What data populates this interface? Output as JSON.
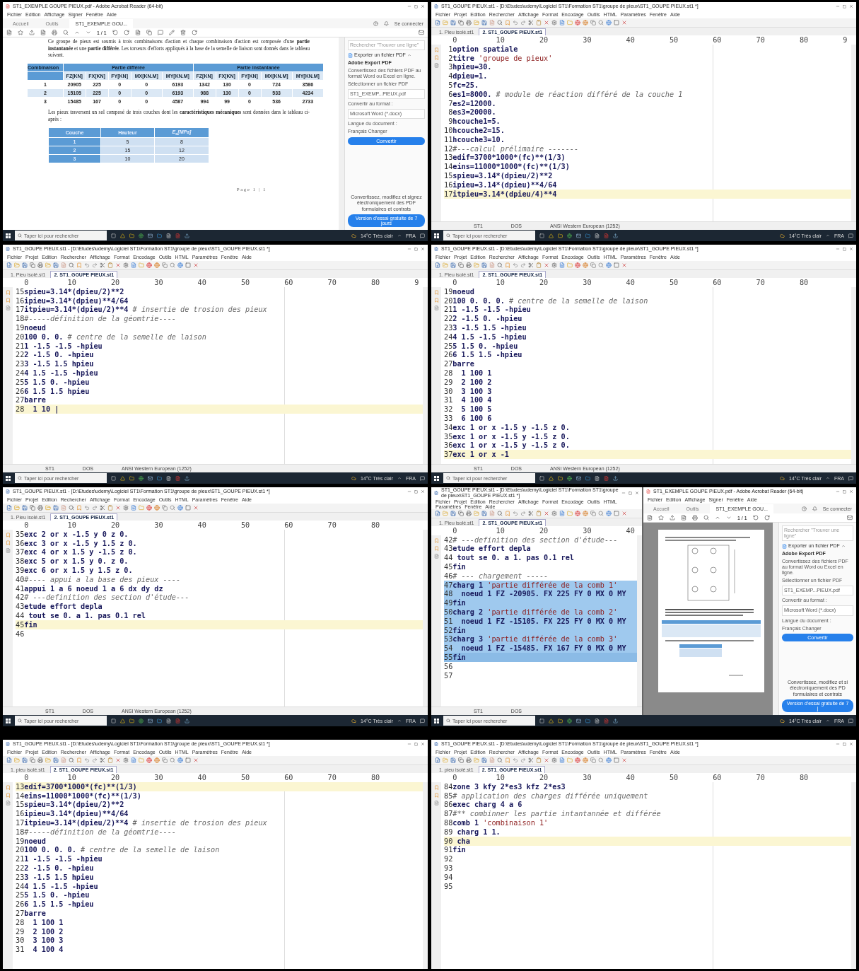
{
  "panels": [
    {
      "kind": "pdf",
      "pdf": {
        "title": "ST1_EXEMPLE GOUPE PIEUX.pdf - Adobe Acrobat Reader (64-bit)",
        "menu": [
          "Fichier",
          "Edition",
          "Affichage",
          "Signer",
          "Fenêtre",
          "Aide"
        ],
        "tabs": [
          {
            "label": "Accueil",
            "selected": false
          },
          {
            "label": "Outils",
            "selected": false
          },
          {
            "label": "ST1_EXEMPLE GOU...",
            "selected": true
          }
        ],
        "account": "Se connecter",
        "page": "1 / 1",
        "doc": {
          "para1": "Ce groupe de pieux est soumis à trois combinaisons d'action et chaque combinaison d'action est composée d'une **partie instantanée** et une **partie différée**. Les torseurs d'efforts appliqués à la base de la semelle de liaison sont donnés dans le tableau suivant.",
          "table1": {
            "groups": [
              "Combinaison",
              "Partie différée",
              "Partie instantanée"
            ],
            "columns": [
              "",
              "FZ[KN]",
              "FX[KN]",
              "FY[KN]",
              "MX[KN.M]",
              "MY[KN.M]",
              "FZ[KN]",
              "FX[KN]",
              "FY[KN]",
              "MX[KN.M]",
              "MY[KN.M]"
            ],
            "rows": [
              [
                "1",
                "20905",
                "225",
                "0",
                "0",
                "6193",
                "1342",
                "130",
                "0",
                "724",
                "3586"
              ],
              [
                "2",
                "15105",
                "225",
                "0",
                "0",
                "6193",
                "988",
                "130",
                "0",
                "533",
                "4234"
              ],
              [
                "3",
                "15485",
                "167",
                "0",
                "0",
                "4587",
                "994",
                "99",
                "0",
                "536",
                "2733"
              ]
            ]
          },
          "para2": "Les pieux traversent un sol composé de trois couches dont les **caractéristiques mécaniques** sont données dans le tableau ci-après :",
          "table2": {
            "columns": [
              "Couche",
              "Hauteur",
              "E$_{s}$[MPa]"
            ],
            "rows": [
              [
                "1",
                "5",
                "8"
              ],
              [
                "2",
                "15",
                "12"
              ],
              [
                "3",
                "10",
                "20"
              ]
            ]
          },
          "footer": "Page 1 | 1"
        },
        "sidebar": {
          "search": "Rechercher \"Trouver une ligne\"",
          "export": "Exporter un fichier PDF",
          "heading": "Adobe Export PDF",
          "desc": "Convertissez des fichiers PDF au format Word ou Excel en ligne.",
          "select_label": "Sélectionner un fichier PDF",
          "file": "ST1_EXEMP...PIEUX.pdf",
          "format_label": "Convertir au format :",
          "format": "Microsoft Word (*.docx)",
          "lang_label": "Langue du document :",
          "lang": "Français  Changer",
          "button": "Convertir",
          "promo": [
            "Convertissez, modifiez et signez",
            "électroniquement des PDF",
            "formulaires et contrats"
          ],
          "promo_button": "Version d'essai gratuite de 7 jours"
        }
      },
      "taskbar": {
        "search": "Taper ici pour rechercher",
        "weather": "14°C  Très clair",
        "lang": "FRA"
      }
    },
    {
      "kind": "editor",
      "editor": {
        "title": "ST1_GOUPE PIEUX.st1 - [D:\\Etudes\\udemy\\Logiciel ST1\\Formation ST1\\groupe de pieux\\ST1_GOUPE PIEUX.st1 *]",
        "menu": [
          "Fichier",
          "Projet",
          "Edition",
          "Rechercher",
          "Affichage",
          "Format",
          "Encodage",
          "Outils",
          "HTML",
          "Paramètres",
          "Fenêtre",
          "Aide"
        ],
        "tabs": [
          {
            "label": "1. Pieu isolé.st1",
            "selected": false
          },
          {
            "label": "2. ST1_GOUPE PIEUX.st1",
            "selected": true
          }
        ],
        "ruler": [
          "0",
          "10",
          "20",
          "30",
          "40",
          "50",
          "60",
          "70",
          "80",
          "9"
        ],
        "lines": [
          {
            "n": "1",
            "parts": [
              {
                "kind": "code",
                "text": "option spatiale"
              }
            ]
          },
          {
            "n": "2",
            "parts": [
              {
                "kind": "code",
                "text": "titre "
              },
              {
                "kind": "string",
                "text": "'groupe de pieux'"
              }
            ]
          },
          {
            "n": "3",
            "parts": [
              {
                "kind": "code",
                "text": "hpieu=30."
              }
            ]
          },
          {
            "n": "4",
            "parts": [
              {
                "kind": "code",
                "text": "dpieu=1."
              }
            ]
          },
          {
            "n": "5",
            "parts": [
              {
                "kind": "code",
                "text": "fc=25."
              }
            ]
          },
          {
            "n": "6",
            "parts": [
              {
                "kind": "code",
                "text": "es1=8000. "
              },
              {
                "kind": "comment",
                "text": "# module de réaction différé de la couche 1"
              }
            ]
          },
          {
            "n": "7",
            "parts": [
              {
                "kind": "code",
                "text": "es2=12000."
              }
            ]
          },
          {
            "n": "8",
            "parts": [
              {
                "kind": "code",
                "text": "es3=20000."
              }
            ]
          },
          {
            "n": "9",
            "parts": [
              {
                "kind": "code",
                "text": "hcouche1=5."
              }
            ]
          },
          {
            "n": "10",
            "parts": [
              {
                "kind": "code",
                "text": "hcouche2=15."
              }
            ]
          },
          {
            "n": "11",
            "parts": [
              {
                "kind": "code",
                "text": "hcouche3=10."
              }
            ]
          },
          {
            "n": "12",
            "parts": [
              {
                "kind": "comment",
                "text": "#---calcul prélimaire -------"
              }
            ]
          },
          {
            "n": "13",
            "parts": [
              {
                "kind": "code",
                "text": "edif=3700*1000*(fc)**(1/3)"
              }
            ]
          },
          {
            "n": "14",
            "parts": [
              {
                "kind": "code",
                "text": "eins=11000*1000*(fc)**(1/3)"
              }
            ]
          },
          {
            "n": "15",
            "parts": [
              {
                "kind": "code",
                "text": "spieu=3.14*(dpieu/2)**2"
              }
            ]
          },
          {
            "n": "16",
            "parts": [
              {
                "kind": "code",
                "text": "ipieu=3.14*(dpieu)**4/64"
              }
            ]
          },
          {
            "n": "17",
            "current": true,
            "parts": [
              {
                "kind": "code",
                "text": "itpieu=3.14*(dpieu/4)**4"
              }
            ]
          }
        ],
        "status": [
          "ST1",
          "DOS",
          "ANSI Western European (1252)"
        ]
      },
      "taskbar": {
        "search": "Taper ici pour rechercher",
        "weather": "14°C  Très clair",
        "lang": "FRA"
      }
    },
    {
      "kind": "editor",
      "editor": {
        "title": "ST1_GOUPE PIEUX.st1 - [D:\\Etudes\\udemy\\Logiciel ST1\\Formation ST1\\groupe de pieux\\ST1_GOUPE PIEUX.st1 *]",
        "menu": [
          "Fichier",
          "Projet",
          "Edition",
          "Rechercher",
          "Affichage",
          "Format",
          "Encodage",
          "Outils",
          "HTML",
          "Paramètres",
          "Fenêtre",
          "Aide"
        ],
        "tabs": [
          {
            "label": "1. Pieu isolé.st1",
            "selected": false
          },
          {
            "label": "2. ST1_GOUPE PIEUX.st1",
            "selected": true
          }
        ],
        "ruler": [
          "0",
          "10",
          "20",
          "30",
          "40",
          "50",
          "60",
          "70",
          "80",
          "9"
        ],
        "lines": [
          {
            "n": "15",
            "parts": [
              {
                "kind": "code",
                "text": "spieu=3.14*(dpieu/2)**2"
              }
            ]
          },
          {
            "n": "16",
            "parts": [
              {
                "kind": "code",
                "text": "ipieu=3.14*(dpieu)**4/64"
              }
            ]
          },
          {
            "n": "17",
            "parts": [
              {
                "kind": "code",
                "text": "itpieu=3.14*(dpieu/2)**4 "
              },
              {
                "kind": "comment",
                "text": "# insertie de trosion des pieux"
              }
            ]
          },
          {
            "n": "18",
            "parts": [
              {
                "kind": "comment",
                "text": "#-----définition de la géomtrie----"
              }
            ]
          },
          {
            "n": "19",
            "parts": [
              {
                "kind": "code",
                "text": "noeud"
              }
            ]
          },
          {
            "n": "20",
            "parts": [
              {
                "kind": "code",
                "text": "100 0. 0. "
              },
              {
                "kind": "comment",
                "text": "# centre de la semelle de laison"
              }
            ]
          },
          {
            "n": "21",
            "parts": [
              {
                "kind": "code",
                "text": "1 -1.5 -1.5 -hpieu"
              }
            ]
          },
          {
            "n": "22",
            "parts": [
              {
                "kind": "code",
                "text": "2 -1.5 0. -hpieu"
              }
            ]
          },
          {
            "n": "23",
            "parts": [
              {
                "kind": "code",
                "text": "3 -1.5 1.5 hpieu"
              }
            ]
          },
          {
            "n": "24",
            "parts": [
              {
                "kind": "code",
                "text": "4 1.5 -1.5 -hpieu"
              }
            ]
          },
          {
            "n": "25",
            "parts": [
              {
                "kind": "code",
                "text": "5 1.5 0. -hpieu"
              }
            ]
          },
          {
            "n": "26",
            "parts": [
              {
                "kind": "code",
                "text": "6 1.5 1.5 hpieu"
              }
            ]
          },
          {
            "n": "27",
            "parts": [
              {
                "kind": "code",
                "text": "barre"
              }
            ]
          },
          {
            "n": "28",
            "current": true,
            "parts": [
              {
                "kind": "code",
                "text": "  1 10 |"
              }
            ]
          }
        ],
        "status": [
          "ST1",
          "DOS",
          "ANSI Western European (1252)"
        ]
      },
      "taskbar": {
        "search": "Taper ici pour rechercher",
        "weather": "14°C  Très clair",
        "lang": "FRA"
      }
    },
    {
      "kind": "editor",
      "editor": {
        "title": "ST1_GOUPE PIEUX.st1 - [D:\\Etudes\\udemy\\Logiciel ST1\\Formation ST1\\groupe de pieux\\ST1_GOUPE PIEUX.st1 *]",
        "menu": [
          "Fichier",
          "Projet",
          "Edition",
          "Rechercher",
          "Affichage",
          "Format",
          "Encodage",
          "Outils",
          "HTML",
          "Paramètres",
          "Fenêtre",
          "Aide"
        ],
        "tabs": [
          {
            "label": "1. Pieu isolé.st1",
            "selected": false
          },
          {
            "label": "2. ST1_GOUPE PIEUX.st1",
            "selected": true
          }
        ],
        "ruler": [
          "0",
          "10",
          "20",
          "30",
          "40",
          "50",
          "60",
          "70",
          "80"
        ],
        "lines": [
          {
            "n": "19",
            "parts": [
              {
                "kind": "code",
                "text": "noeud"
              }
            ]
          },
          {
            "n": "20",
            "parts": [
              {
                "kind": "code",
                "text": "100 0. 0. 0. "
              },
              {
                "kind": "comment",
                "text": "# centre de la semelle de laison"
              }
            ]
          },
          {
            "n": "21",
            "parts": [
              {
                "kind": "code",
                "text": "1 -1.5 -1.5 -hpieu"
              }
            ]
          },
          {
            "n": "22",
            "parts": [
              {
                "kind": "code",
                "text": "2 -1.5 0. -hpieu"
              }
            ]
          },
          {
            "n": "23",
            "parts": [
              {
                "kind": "code",
                "text": "3 -1.5 1.5 -hpieu"
              }
            ]
          },
          {
            "n": "24",
            "parts": [
              {
                "kind": "code",
                "text": "4 1.5 -1.5 -hpieu"
              }
            ]
          },
          {
            "n": "25",
            "parts": [
              {
                "kind": "code",
                "text": "5 1.5 0. -hpieu"
              }
            ]
          },
          {
            "n": "26",
            "parts": [
              {
                "kind": "code",
                "text": "6 1.5 1.5 -hpieu"
              }
            ]
          },
          {
            "n": "27",
            "parts": [
              {
                "kind": "code",
                "text": "barre"
              }
            ]
          },
          {
            "n": "28",
            "parts": [
              {
                "kind": "code",
                "text": "  1 100 1"
              }
            ]
          },
          {
            "n": "29",
            "parts": [
              {
                "kind": "code",
                "text": "  2 100 2"
              }
            ]
          },
          {
            "n": "30",
            "parts": [
              {
                "kind": "code",
                "text": "  3 100 3"
              }
            ]
          },
          {
            "n": "31",
            "parts": [
              {
                "kind": "code",
                "text": "  4 100 4"
              }
            ]
          },
          {
            "n": "32",
            "parts": [
              {
                "kind": "code",
                "text": "  5 100 5"
              }
            ]
          },
          {
            "n": "33",
            "parts": [
              {
                "kind": "code",
                "text": "  6 100 6"
              }
            ]
          },
          {
            "n": "34",
            "parts": [
              {
                "kind": "code",
                "text": "exc 1 or x -1.5 y -1.5 z 0."
              }
            ]
          },
          {
            "n": "35",
            "parts": [
              {
                "kind": "code",
                "text": "exc 1 or x -1.5 y -1.5 z 0."
              }
            ]
          },
          {
            "n": "36",
            "parts": [
              {
                "kind": "code",
                "text": "exc 1 or x -1.5 y -1.5 z 0."
              }
            ]
          },
          {
            "n": "37",
            "current": true,
            "parts": [
              {
                "kind": "code",
                "text": "exc 1 or x -1"
              }
            ]
          }
        ],
        "status": [
          "ST1",
          "DOS",
          "ANSI Western European (1252)"
        ]
      },
      "taskbar": {
        "search": "Taper ici pour rechercher",
        "weather": "14°C  Très clair",
        "lang": "FRA"
      }
    },
    {
      "kind": "editor",
      "editor": {
        "title": "ST1_GOUPE PIEUX.st1 - [D:\\Etudes\\udemy\\Logiciel ST1\\Formation ST1\\groupe de pieux\\ST1_GOUPE PIEUX.st1 *]",
        "menu": [
          "Fichier",
          "Projet",
          "Edition",
          "Rechercher",
          "Affichage",
          "Format",
          "Encodage",
          "Outils",
          "HTML",
          "Paramètres",
          "Fenêtre",
          "Aide"
        ],
        "tabs": [
          {
            "label": "1. Pieu isolé.st1",
            "selected": false
          },
          {
            "label": "2. ST1_GOUPE PIEUX.st1",
            "selected": true
          }
        ],
        "ruler": [
          "0",
          "10",
          "20",
          "30",
          "40",
          "50",
          "60",
          "70",
          "80"
        ],
        "lines": [
          {
            "n": "35",
            "parts": [
              {
                "kind": "code",
                "text": "exc 2 or x -1.5 y 0 z 0."
              }
            ]
          },
          {
            "n": "36",
            "parts": [
              {
                "kind": "code",
                "text": "exc 3 or x -1.5 y 1.5 z 0."
              }
            ]
          },
          {
            "n": "37",
            "parts": [
              {
                "kind": "code",
                "text": "exc 4 or x 1.5 y -1.5 z 0."
              }
            ]
          },
          {
            "n": "38",
            "parts": [
              {
                "kind": "code",
                "text": "exc 5 or x 1.5 y 0. z 0."
              }
            ]
          },
          {
            "n": "39",
            "parts": [
              {
                "kind": "code",
                "text": "exc 6 or x 1.5 y 1.5 z 0."
              }
            ]
          },
          {
            "n": "40",
            "parts": [
              {
                "kind": "comment",
                "text": "#---- appui a la base des pieux ----"
              }
            ]
          },
          {
            "n": "41",
            "parts": [
              {
                "kind": "code",
                "text": "appui 1 a 6 noeud 1 a 6 dx dy dz"
              }
            ]
          },
          {
            "n": "42",
            "parts": [
              {
                "kind": "comment",
                "text": "# ---definition des section d'étude---"
              }
            ]
          },
          {
            "n": "43",
            "parts": [
              {
                "kind": "code",
                "text": "etude effort depla"
              }
            ]
          },
          {
            "n": "44",
            "parts": [
              {
                "kind": "code",
                "text": " tout se 0. a 1. pas 0.1 rel"
              }
            ]
          },
          {
            "n": "45",
            "current": true,
            "parts": [
              {
                "kind": "code",
                "text": "fin"
              }
            ]
          },
          {
            "n": "46"
          }
        ],
        "status": [
          "ST1",
          "DOS",
          "ANSI Western European (1252)"
        ]
      },
      "taskbar": {
        "search": "Taper ici pour rechercher",
        "weather": "14°C  Très clair",
        "lang": "FRA"
      }
    },
    {
      "kind": "split",
      "editor": {
        "title": "ST1_GOUPE PIEUX.st1 - [D:\\Etudes\\udemy\\Logiciel ST1\\Formation ST1\\groupe de pieux\\ST1_GOUPE PIEUX.st1 *]",
        "menu": [
          "Fichier",
          "Projet",
          "Edition",
          "Rechercher",
          "Affichage",
          "Format",
          "Encodage",
          "Outils",
          "HTML",
          "Paramètres",
          "Fenêtre",
          "Aide"
        ],
        "tabs": [
          {
            "label": "1. Pieu isolé.st1",
            "selected": false
          },
          {
            "label": "2. ST1_GOUPE PIEUX.st1",
            "selected": true
          }
        ],
        "ruler": [
          "0",
          "10",
          "20",
          "30",
          "40"
        ],
        "lines": [
          {
            "n": "42",
            "parts": [
              {
                "kind": "comment",
                "text": "# ---definition des section d'étude---"
              }
            ]
          },
          {
            "n": "43",
            "parts": [
              {
                "kind": "code",
                "text": "etude effort depla"
              }
            ]
          },
          {
            "n": "44",
            "parts": [
              {
                "kind": "code",
                "text": " tout se 0. a 1. pas 0.1 rel"
              }
            ]
          },
          {
            "n": "45",
            "parts": [
              {
                "kind": "code",
                "text": "fin"
              }
            ]
          },
          {
            "n": "46",
            "parts": [
              {
                "kind": "comment",
                "text": "# --- chargement -----"
              }
            ]
          },
          {
            "n": "47",
            "selected": true,
            "parts": [
              {
                "kind": "code",
                "text": "charg 1 "
              },
              {
                "kind": "string",
                "text": "'partie différée de la comb 1'"
              }
            ]
          },
          {
            "n": "48",
            "selected": true,
            "parts": [
              {
                "kind": "code",
                "text": "  noeud 1 FZ -20905. FX 225 FY 0 MX 0 MY"
              }
            ]
          },
          {
            "n": "49",
            "selected": true,
            "parts": [
              {
                "kind": "code",
                "text": "fin"
              }
            ]
          },
          {
            "n": "50",
            "selected": true,
            "parts": [
              {
                "kind": "code",
                "text": "charg 2 "
              },
              {
                "kind": "string",
                "text": "'partie différée de la comb 2'"
              }
            ]
          },
          {
            "n": "51",
            "selected": true,
            "parts": [
              {
                "kind": "code",
                "text": "  noeud 1 FZ -15105. FX 225 FY 0 MX 0 MY"
              }
            ]
          },
          {
            "n": "52",
            "selected": true,
            "parts": [
              {
                "kind": "code",
                "text": "fin"
              }
            ]
          },
          {
            "n": "53",
            "selected": true,
            "parts": [
              {
                "kind": "code",
                "text": "charg 3 "
              },
              {
                "kind": "string",
                "text": "'partie différée de la comb 3'"
              }
            ]
          },
          {
            "n": "54",
            "selected": true,
            "parts": [
              {
                "kind": "code",
                "text": "  noeud 1 FZ -15485. FX 167 FY 0 MX 0 MY"
              }
            ]
          },
          {
            "n": "55",
            "selected": true,
            "current": true,
            "parts": [
              {
                "kind": "code",
                "text": "fin"
              }
            ]
          },
          {
            "n": "56"
          },
          {
            "n": "57"
          }
        ],
        "status": [
          "ST1",
          "DOS"
        ]
      },
      "pdf": {
        "title": "ST1_EXEMPLE GOUPE PIEUX.pdf - Adobe Acrobat Reader (64-bit)",
        "menu": [
          "Fichier",
          "Edition",
          "Affichage",
          "Signer",
          "Fenêtre",
          "Aide"
        ],
        "tabs": [
          {
            "label": "Accueil",
            "selected": false
          },
          {
            "label": "Outils",
            "selected": false
          },
          {
            "label": "ST1_EXEMPLE GOU...",
            "selected": true
          }
        ],
        "account": "Se connecter",
        "page": "1 / 1",
        "sidebar": {
          "search": "Rechercher \"Trouver une ligne\"",
          "export": "Exporter un fichier PDF",
          "heading": "Adobe Export PDF",
          "desc": "Convertissez des fichiers PDF au format Word ou Excel en ligne.",
          "select_label": "Sélectionner un fichier PDF",
          "file": "ST1_EXEMP...PIEUX.pdf",
          "format_label": "Convertir au format :",
          "format": "Microsoft Word (*.docx)",
          "lang_label": "Langue du document :",
          "lang": "Français  Changer",
          "button": "Convertir",
          "promo": [
            "Convertissez, modifiez et si",
            "électroniquement des PD",
            "formulaires et contrats"
          ],
          "promo_button": "Version d'essai gratuite de 7 j"
        }
      },
      "taskbar": {
        "search": "Taper ici pour rechercher",
        "weather": "14°C  Très clair",
        "lang": "FRA"
      }
    },
    {
      "kind": "editor",
      "editor": {
        "title": "ST1_GOUPE PIEUX.st1 - [D:\\Etudes\\udemy\\Logiciel ST1\\Formation ST1\\groupe de pieux\\ST1_GOUPE PIEUX.st1 *]",
        "menu": [
          "Fichier",
          "Projet",
          "Edition",
          "Rechercher",
          "Affichage",
          "Format",
          "Encodage",
          "Outils",
          "HTML",
          "Paramètres",
          "Fenêtre",
          "Aide"
        ],
        "tabs": [
          {
            "label": "1. pieu isolé.st1",
            "selected": false
          },
          {
            "label": "2. ST1_GOUPE PIEUX.st1",
            "selected": true
          }
        ],
        "ruler": [
          "0",
          "10",
          "20",
          "30",
          "40",
          "50",
          "60",
          "70",
          "80"
        ],
        "lines": [
          {
            "n": "13",
            "current": true,
            "parts": [
              {
                "kind": "code",
                "text": "edif=3700*1000*(fc)**(1/3)"
              }
            ]
          },
          {
            "n": "14",
            "parts": [
              {
                "kind": "code",
                "text": "eins=11000*1000*(fc)**(1/3)"
              }
            ]
          },
          {
            "n": "15",
            "parts": [
              {
                "kind": "code",
                "text": "spieu=3.14*(dpieu/2)**2"
              }
            ]
          },
          {
            "n": "16",
            "parts": [
              {
                "kind": "code",
                "text": "ipieu=3.14*(dpieu)**4/64"
              }
            ]
          },
          {
            "n": "17",
            "parts": [
              {
                "kind": "code",
                "text": "itpieu=3.14*(dpieu/2)**4 "
              },
              {
                "kind": "comment",
                "text": "# insertie de trosion des pieux"
              }
            ]
          },
          {
            "n": "18",
            "parts": [
              {
                "kind": "comment",
                "text": "#-----définition de la géomtrie----"
              }
            ]
          },
          {
            "n": "19",
            "parts": [
              {
                "kind": "code",
                "text": "noeud"
              }
            ]
          },
          {
            "n": "20",
            "parts": [
              {
                "kind": "code",
                "text": "100 0. 0. 0. "
              },
              {
                "kind": "comment",
                "text": "# centre de la semelle de laison"
              }
            ]
          },
          {
            "n": "21",
            "parts": [
              {
                "kind": "code",
                "text": "1 -1.5 -1.5 -hpieu"
              }
            ]
          },
          {
            "n": "22",
            "parts": [
              {
                "kind": "code",
                "text": "2 -1.5 0. -hpieu"
              }
            ]
          },
          {
            "n": "23",
            "parts": [
              {
                "kind": "code",
                "text": "3 -1.5 1.5 hpieu"
              }
            ]
          },
          {
            "n": "24",
            "parts": [
              {
                "kind": "code",
                "text": "4 1.5 -1.5 -hpieu"
              }
            ]
          },
          {
            "n": "25",
            "parts": [
              {
                "kind": "code",
                "text": "5 1.5 0. -hpieu"
              }
            ]
          },
          {
            "n": "26",
            "parts": [
              {
                "kind": "code",
                "text": "6 1.5 1.5 -hpieu"
              }
            ]
          },
          {
            "n": "27",
            "parts": [
              {
                "kind": "code",
                "text": "barre"
              }
            ]
          },
          {
            "n": "28",
            "parts": [
              {
                "kind": "code",
                "text": "  1 100 1"
              }
            ]
          },
          {
            "n": "29",
            "parts": [
              {
                "kind": "code",
                "text": "  2 100 2"
              }
            ]
          },
          {
            "n": "30",
            "parts": [
              {
                "kind": "code",
                "text": "  3 100 3"
              }
            ]
          },
          {
            "n": "31",
            "parts": [
              {
                "kind": "code",
                "text": "  4 100 4"
              }
            ]
          }
        ]
      }
    },
    {
      "kind": "editor",
      "editor": {
        "title": "ST1_GOUPE PIEUX.st1 - [D:\\Etudes\\udemy\\Logiciel ST1\\Formation ST1\\groupe de pieux\\ST1_GOUPE PIEUX.st1 *]",
        "menu": [
          "Fichier",
          "Projet",
          "Edition",
          "Rechercher",
          "Affichage",
          "Format",
          "Encodage",
          "Outils",
          "HTML",
          "Paramètres",
          "Fenêtre",
          "Aide"
        ],
        "tabs": [
          {
            "label": "1. pieu isolé.st1",
            "selected": false
          },
          {
            "label": "2. ST1_GOUPE PIEUX.st1",
            "selected": true
          }
        ],
        "ruler": [
          "0",
          "10",
          "20",
          "30",
          "40",
          "50",
          "60",
          "70",
          "80"
        ],
        "lines": [
          {
            "n": "84",
            "parts": [
              {
                "kind": "code",
                "text": "zone 3 kfy 2*es3 kfz 2*es3"
              }
            ]
          },
          {
            "n": "85",
            "parts": [
              {
                "kind": "comment",
                "text": "# application des charges différée uniquement"
              }
            ]
          },
          {
            "n": "86",
            "parts": [
              {
                "kind": "code",
                "text": "exec charg 4 a 6"
              }
            ]
          },
          {
            "n": "87",
            "parts": [
              {
                "kind": "comment",
                "text": "#** combinner les partie intantannée et différée"
              }
            ]
          },
          {
            "n": "88",
            "parts": [
              {
                "kind": "code",
                "text": "comb 1 "
              },
              {
                "kind": "string",
                "text": "'combinaison 1'"
              }
            ]
          },
          {
            "n": "89",
            "parts": [
              {
                "kind": "code",
                "text": " charg 1 1."
              }
            ]
          },
          {
            "n": "90",
            "current": true,
            "parts": [
              {
                "kind": "code",
                "text": " cha"
              }
            ]
          },
          {
            "n": "91",
            "parts": [
              {
                "kind": "code",
                "text": "fin"
              }
            ]
          },
          {
            "n": "92"
          },
          {
            "n": "93"
          },
          {
            "n": "94"
          },
          {
            "n": "95"
          }
        ]
      }
    }
  ]
}
